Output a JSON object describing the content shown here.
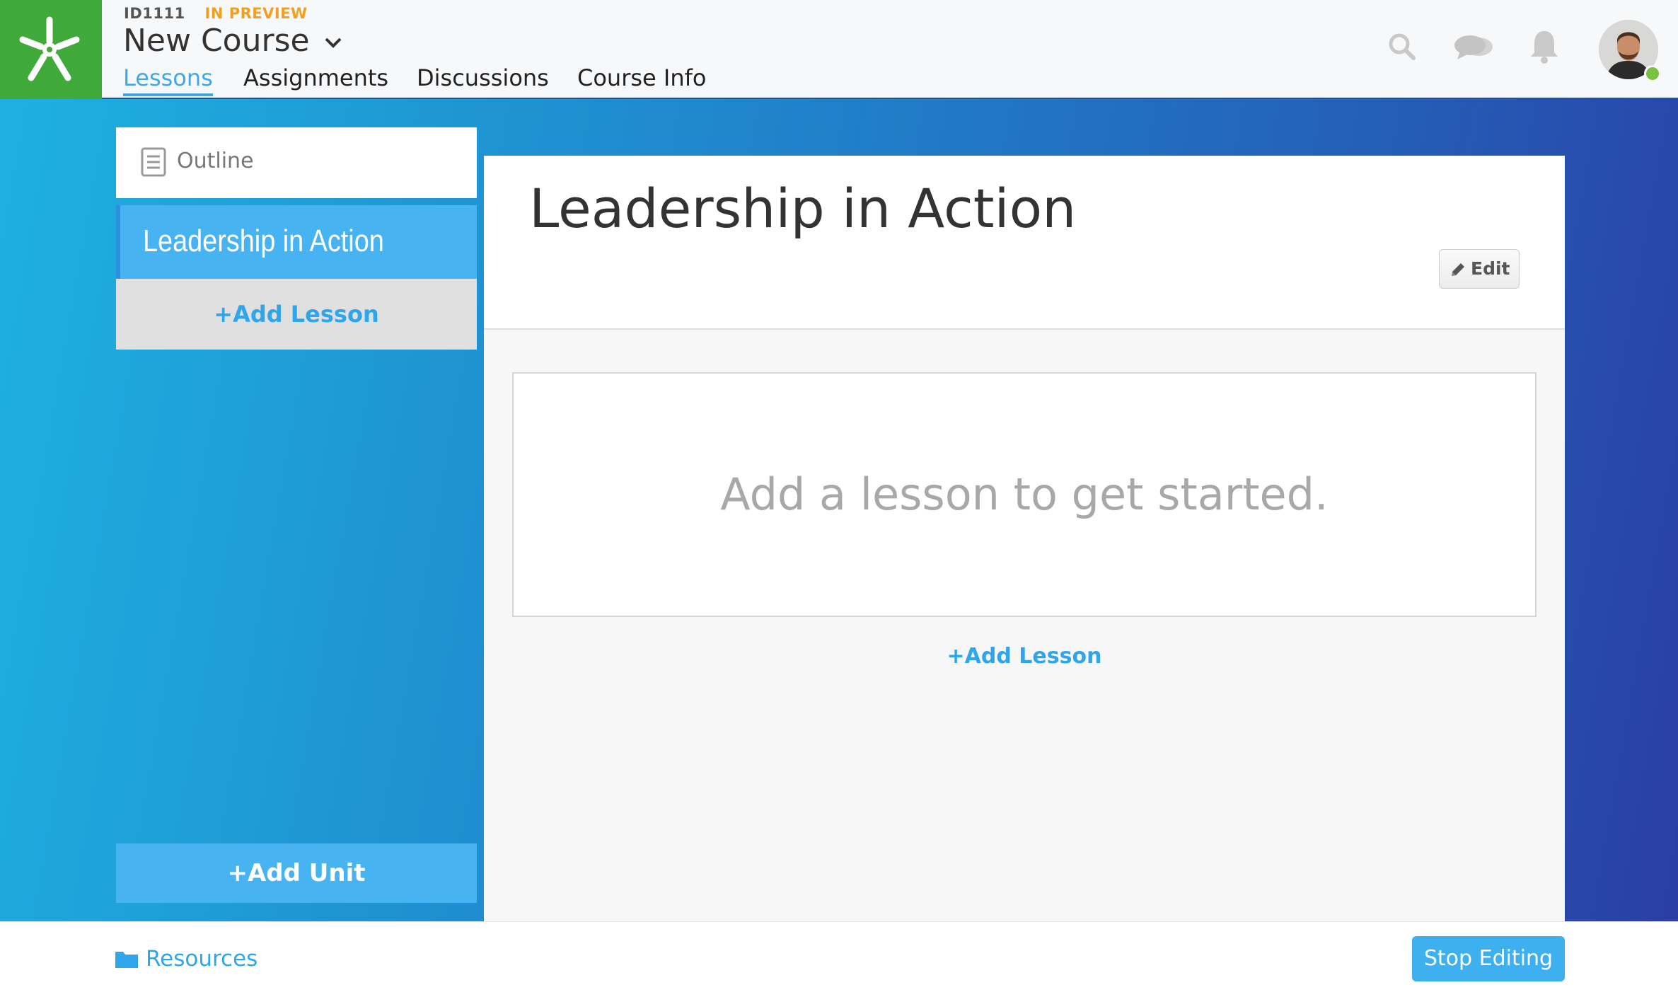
{
  "header": {
    "course_id": "ID1111",
    "status": "IN PREVIEW",
    "course_title": "New Course",
    "tabs": [
      {
        "label": "Lessons",
        "active": true
      },
      {
        "label": "Assignments",
        "active": false
      },
      {
        "label": "Discussions",
        "active": false
      },
      {
        "label": "Course Info",
        "active": false
      }
    ],
    "icons": [
      "search-icon",
      "chat-icon",
      "bell-icon"
    ],
    "user_online": true
  },
  "sidebar": {
    "outline_label": "Outline",
    "units": [
      {
        "label": "Leadership in Action",
        "selected": true
      }
    ],
    "add_lesson_label": "+Add Lesson",
    "add_unit_label": "+Add Unit"
  },
  "main": {
    "unit_title": "Leadership in Action",
    "edit_label": "Edit",
    "empty_message": "Add a lesson to get started.",
    "add_lesson_label": "+Add Lesson"
  },
  "footer": {
    "resources_label": "Resources",
    "stop_editing_label": "Stop Editing"
  },
  "colors": {
    "brand_green": "#3fa93a",
    "accent_blue": "#3fa9e8",
    "status_orange": "#f0a020"
  }
}
